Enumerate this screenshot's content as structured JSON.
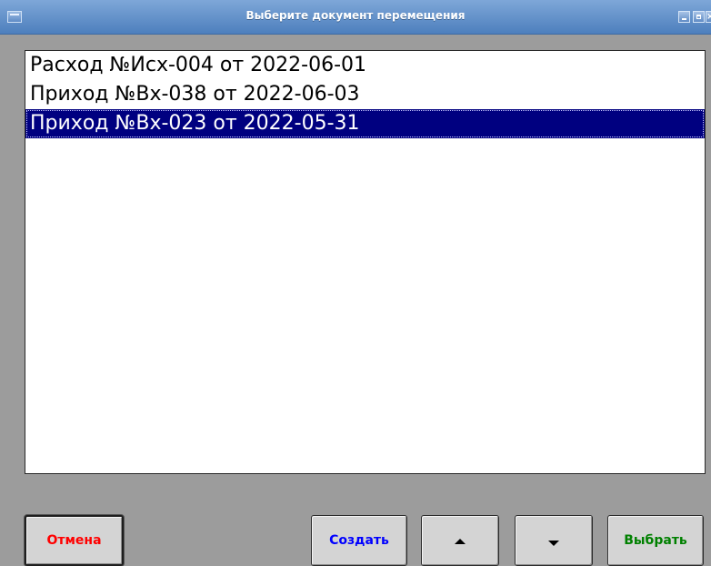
{
  "window": {
    "title": "Выберите документ перемещения",
    "controls": [
      "minimize-icon",
      "maximize-icon",
      "close-icon"
    ]
  },
  "list": {
    "items": [
      {
        "label": "Расход №Исх-004 от 2022-06-01",
        "selected": false
      },
      {
        "label": "Приход №Вх-038 от 2022-06-03",
        "selected": false
      },
      {
        "label": "Приход №Вх-023 от 2022-05-31",
        "selected": true
      }
    ]
  },
  "buttons": {
    "cancel": {
      "label": "Отмена",
      "color": "#ff0000"
    },
    "create": {
      "label": "Создать",
      "color": "#0000ff"
    },
    "up": {
      "icon": "arrow-up-icon"
    },
    "down": {
      "icon": "arrow-down-icon"
    },
    "select": {
      "label": "Выбрать",
      "color": "#008000"
    }
  },
  "colors": {
    "selection_background": "#000080",
    "selection_text": "#ffffff",
    "titlebar": "#5c8cc8",
    "panel_background": "#9c9c9c"
  }
}
